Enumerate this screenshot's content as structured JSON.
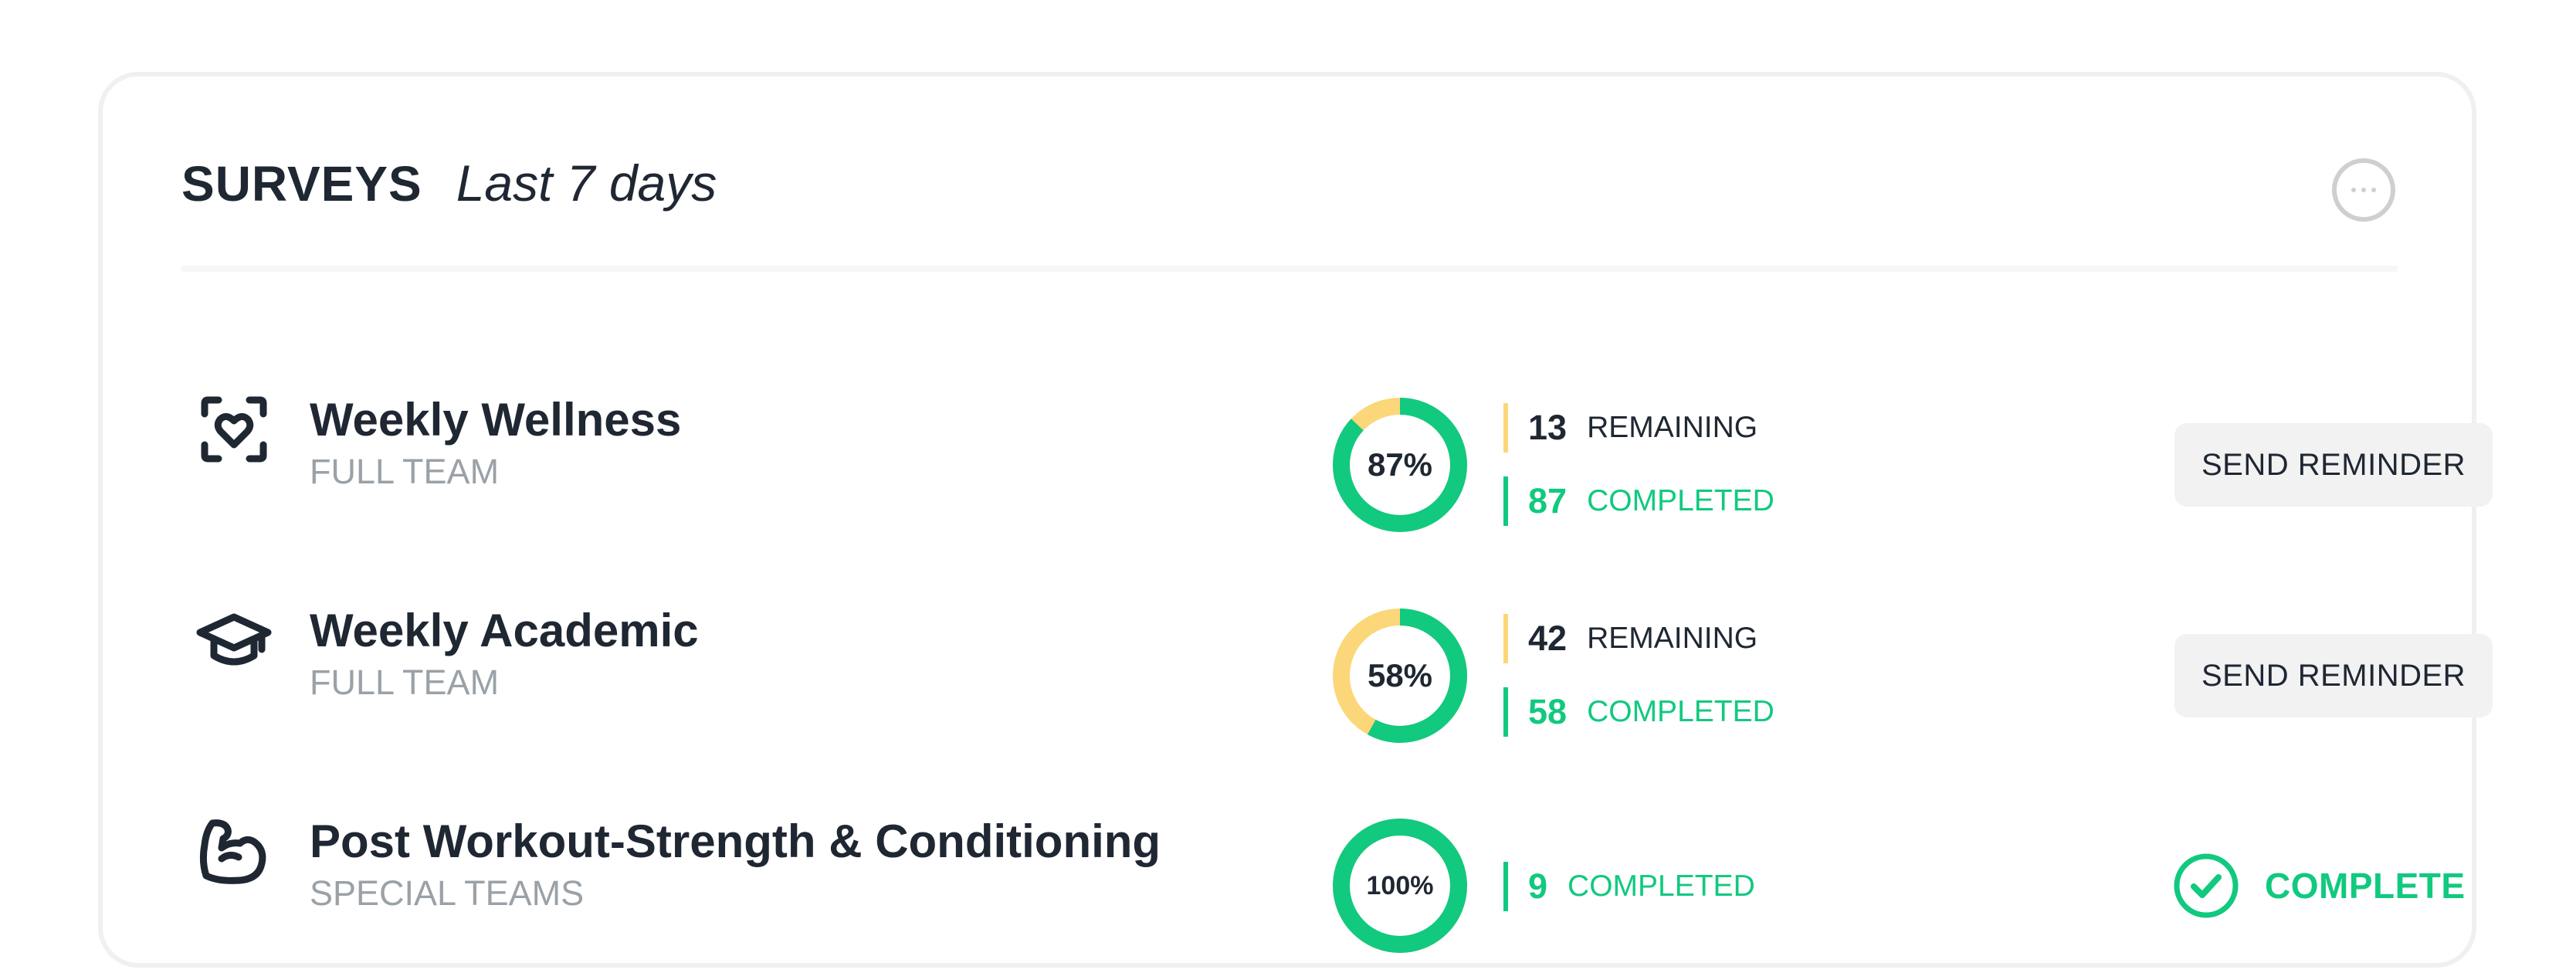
{
  "header": {
    "title": "SURVEYS",
    "subtitle": "Last 7 days",
    "more_icon": "more-horizontal-icon"
  },
  "colors": {
    "completed": "#11c97f",
    "remaining": "#fbd77a",
    "text": "#1f2733",
    "muted": "#9aa1a7"
  },
  "surveys": [
    {
      "icon": "heart-scan-icon",
      "name": "Weekly Wellness",
      "team": "FULL TEAM",
      "percent_label": "87%",
      "completed_fraction": 0.87,
      "remaining_count": "13",
      "remaining_label": "REMAINING",
      "completed_count": "87",
      "completed_label": "COMPLETED",
      "action_label": "SEND REMINDER"
    },
    {
      "icon": "graduation-cap-icon",
      "name": "Weekly Academic",
      "team": "FULL TEAM",
      "percent_label": "58%",
      "completed_fraction": 0.58,
      "remaining_count": "42",
      "remaining_label": "REMAINING",
      "completed_count": "58",
      "completed_label": "COMPLETED",
      "action_label": "SEND REMINDER"
    },
    {
      "icon": "flexed-bicep-icon",
      "name": "Post Workout-Strength & Conditioning",
      "team": "SPECIAL TEAMS",
      "percent_label": "100%",
      "completed_fraction": 1.0,
      "completed_count": "9",
      "completed_label": "COMPLETED",
      "status_label": "COMPLETE",
      "status_icon": "check-circle-icon"
    }
  ]
}
